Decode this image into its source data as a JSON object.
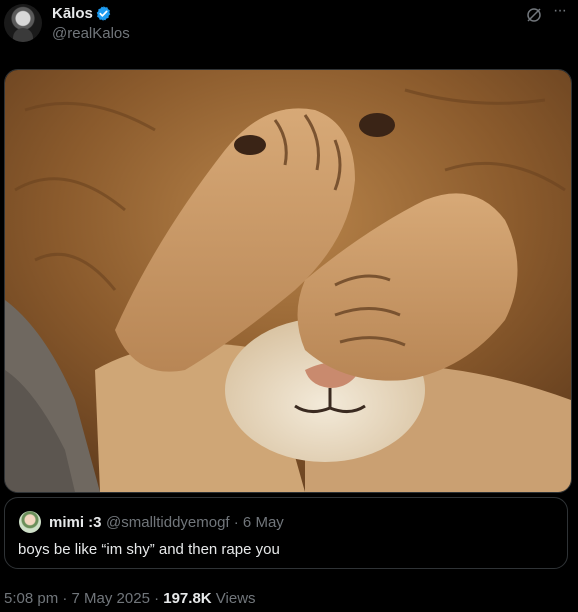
{
  "tweet": {
    "display_name": "Kālos",
    "handle": "@realKalos",
    "photo_alt": "lion covering its face with its paws"
  },
  "quote": {
    "name": "mimi :3",
    "handle_and_date": "@smalltiddyemogf · 6 May",
    "text": "boys be like “im shy” and then rape you"
  },
  "footer": {
    "time": "5:08 pm · 7 May 2025 · ",
    "views_count": "197.8K",
    "views_label": " Views"
  },
  "colors": {
    "background": "#000000",
    "text": "#e7e9ea",
    "muted": "#71767b",
    "verified": "#1d9bf0",
    "border": "#2f3336"
  },
  "icons": [
    "verified-badge-icon",
    "grok-icon",
    "more-icon"
  ]
}
